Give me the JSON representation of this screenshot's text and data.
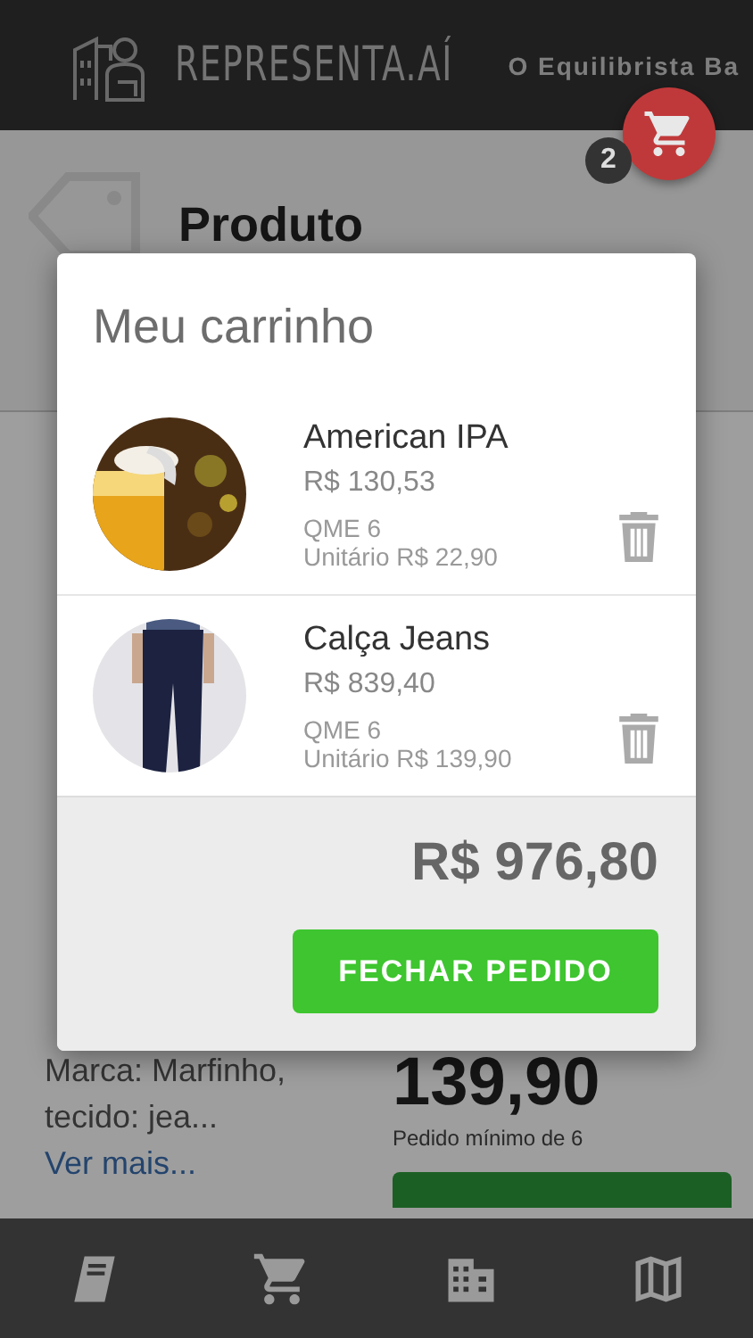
{
  "header": {
    "brand": "REPRESENTA.AÍ",
    "store": "O Equilibrista Ba"
  },
  "cart_button": {
    "badge": "2"
  },
  "page": {
    "title": "Produto",
    "description": "Marca: Marfinho, tecido: jea...",
    "more_link": "Ver mais...",
    "price": "139,90",
    "min_order": "Pedido mínimo de 6"
  },
  "cart": {
    "title": "Meu carrinho",
    "items": [
      {
        "name": "American IPA",
        "total": "R$ 130,53",
        "qme": "QME 6",
        "unit": "Unitário R$ 22,90",
        "kind": "picture"
      },
      {
        "name": "Calça Jeans",
        "total": "R$ 839,40",
        "qme": "QME 6",
        "unit": "Unitário R$ 139,90",
        "kind": "picture"
      }
    ],
    "total": "R$ 976,80",
    "checkout": "FECHAR PEDIDO"
  },
  "bottom_nav": [
    {
      "kind": "book"
    },
    {
      "kind": "cart"
    },
    {
      "kind": "building"
    },
    {
      "kind": "map"
    }
  ]
}
